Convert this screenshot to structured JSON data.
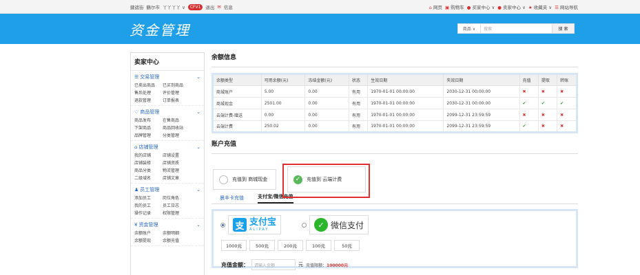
{
  "topbar": {
    "left": [
      "鍵遮街",
      "鶴尔市",
      "丫丫丫丫 ∨"
    ],
    "badge": "CFV1",
    "logout": "退出",
    "msg_icon": "mail-icon",
    "msg": "信息",
    "right": [
      {
        "icon": "home-icon",
        "label": "网页"
      },
      {
        "icon": "cart-icon",
        "label": "购物车"
      },
      {
        "icon": "user-icon",
        "label": "买家中心 ∨"
      },
      {
        "icon": "user-icon",
        "label": "卖家中心 ∨"
      },
      {
        "icon": "star-icon",
        "label": "收藏夹 ∨"
      },
      {
        "icon": "list-icon",
        "label": "网站导航"
      }
    ]
  },
  "header": {
    "logo": "资金管理",
    "search_select": "商品 ∨",
    "search_placeholder": "搜索",
    "search_button": "搜 索"
  },
  "sidebar": {
    "title": "卖家中心",
    "groups": [
      {
        "icon": "list-icon",
        "title": "交易管理",
        "items": [
          "已卖出商品",
          "已买到商品",
          "售后处理",
          "评价管理",
          "退款管理",
          "订单报表"
        ]
      },
      {
        "icon": "heart-icon",
        "title": "商品管理",
        "items": [
          "商品发布",
          "在售商品",
          "下架商品",
          "商品回收站",
          "品牌管理",
          "分类管理"
        ]
      },
      {
        "icon": "home-icon",
        "title": "店铺管理",
        "items": [
          "我的店铺",
          "店铺设置",
          "店铺装修",
          "店铺资质",
          "商品分类",
          "物流管理",
          "二级域名",
          "店铺文章"
        ]
      },
      {
        "icon": "users-icon",
        "title": "员工管理",
        "items": [
          "添加员工",
          "岗位角色",
          "我的员工",
          "员工日志",
          "操作记录",
          "权限管理"
        ]
      },
      {
        "icon": "money-icon",
        "title": "资金管理",
        "items": [
          "余额账户",
          "余额明细",
          "余额提现",
          "余额充值"
        ]
      }
    ]
  },
  "balance": {
    "title": "余额信息",
    "headers": [
      "余额类型",
      "可用余额(元)",
      "冻结金额(元)",
      "状态",
      "生效日期",
      "失效日期",
      "充值",
      "提取",
      "转账"
    ],
    "rows": [
      [
        "商城账户",
        "5.00",
        "0.00",
        "有用",
        "1970-01-01 00:00:00",
        "2030-12-31 00:00:00",
        "no",
        "no",
        "no"
      ],
      [
        "商城现金",
        "2501.00",
        "0.00",
        "有用",
        "1970-01-01 00:00:00",
        "2030-12-31 00:00:00",
        "ok",
        "ok",
        "ok"
      ],
      [
        "云端计费-赠送",
        "0.00",
        "0.00",
        "有用",
        "1970-01-01 00:00:00",
        "2099-12-31 23:59:59",
        "no",
        "no",
        "no"
      ],
      [
        "云端计费",
        "250.02",
        "0.00",
        "有用",
        "1970-01-01 00:00:00",
        "2099-12-31 23:59:59",
        "ok",
        "no",
        "no"
      ]
    ]
  },
  "recharge": {
    "title": "账户充值",
    "option1": "充值到 商城现金",
    "option2": "充值到 云端计费",
    "tabs": [
      "晨丰卡充值",
      "支付宝/微信充值"
    ],
    "alipay_cn": "支付宝",
    "alipay_en": "ALIPAY",
    "wechat": "微信支付",
    "amounts": [
      "1000元",
      "500元",
      "200元",
      "100元",
      "50元"
    ],
    "amount_label": "充值金额：",
    "amount_placeholder": "请输入金额",
    "unit": "元",
    "limit_label": "充值限额：",
    "limit_value": "100000元"
  },
  "colors": {
    "brand": "#1e9fe7",
    "highlight": "#e22d2d",
    "ok": "#2ca12c",
    "no": "#d62f2f"
  }
}
